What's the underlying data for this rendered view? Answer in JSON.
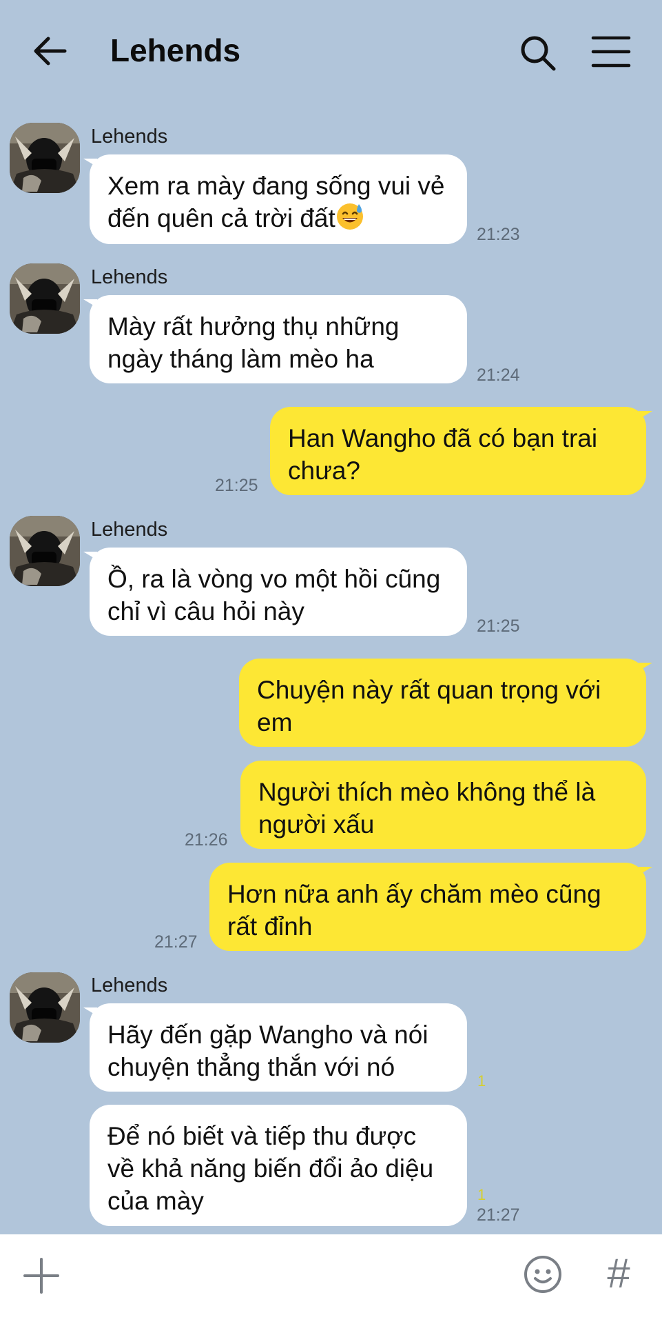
{
  "header": {
    "title": "Lehends",
    "back_icon": "arrow-left-icon",
    "search_icon": "search-icon",
    "menu_icon": "hamburger-menu-icon"
  },
  "messages": [
    {
      "sender": "Lehends",
      "text": "Xem ra mày đang sống vui vẻ đến quên cả trời đất",
      "emoji": "sweat-smile-emoji",
      "time": "21:23"
    },
    {
      "sender": "Lehends",
      "text": "Mày rất hưởng thụ những ngày tháng làm mèo ha",
      "time": "21:24"
    },
    {
      "text": "Han Wangho đã có bạn trai chưa?",
      "time": "21:25"
    },
    {
      "sender": "Lehends",
      "text": "Ồ, ra là vòng vo một hồi cũng chỉ vì câu hỏi này",
      "time": "21:25"
    },
    {
      "text": "Chuyện này rất quan trọng với em"
    },
    {
      "text": "Người thích mèo không thể là người xấu",
      "time": "21:26"
    },
    {
      "text": "Hơn nữa anh ấy chăm mèo cũng rất đỉnh",
      "time": "21:27"
    },
    {
      "sender": "Lehends",
      "text": "Hãy đến gặp Wangho và nói chuyện thẳng thắn với nó",
      "unread": "1"
    },
    {
      "text": "Để nó biết và tiếp thu được về khả năng biến đổi ảo diệu của mày",
      "unread": "1",
      "time": "21:27"
    }
  ],
  "input_bar": {
    "plus_icon": "plus-icon",
    "emoticon_icon": "smiley-face-icon",
    "hashtag_label": "#"
  },
  "colors": {
    "background": "#b1c5da",
    "incoming_bubble": "#ffffff",
    "outgoing_bubble": "#fde734",
    "timestamp": "#5d6a78",
    "unread_count": "#d6cf2f"
  }
}
